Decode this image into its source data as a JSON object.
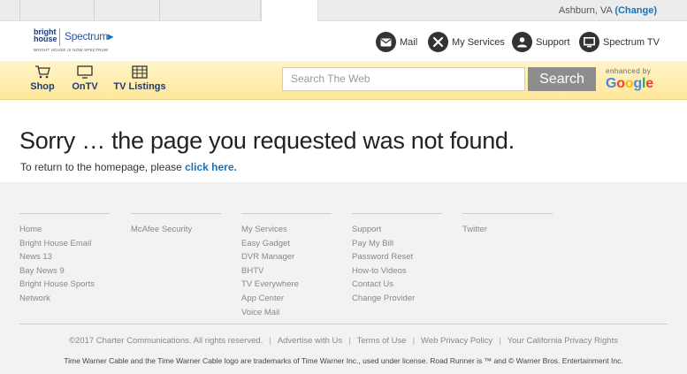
{
  "top": {
    "location": "Ashburn, VA",
    "change": "(Change)"
  },
  "logo": {
    "bright": "bright",
    "house": "house",
    "spectrum": "Spectrum",
    "tagline": "BRIGHT HOUSE IS NOW SPECTRUM"
  },
  "services": {
    "mail": "Mail",
    "my_services": "My Services",
    "support": "Support",
    "spectrum_tv": "Spectrum TV"
  },
  "nav": {
    "shop": "Shop",
    "ontv": "OnTV",
    "tv_listings": "TV Listings"
  },
  "search": {
    "placeholder": "Search The Web",
    "button": "Search",
    "enhanced": "enhanced by",
    "google": [
      "G",
      "o",
      "o",
      "g",
      "l",
      "e"
    ]
  },
  "error": {
    "title": "Sorry … the page you requested was not found.",
    "prefix": "To return to the homepage, please ",
    "link": "click here."
  },
  "footer": {
    "col1": [
      "Home",
      "Bright House Email",
      "News 13",
      "Bay News 9",
      "Bright House Sports",
      "Network"
    ],
    "col2": [
      "McAfee Security"
    ],
    "col3": [
      "My Services",
      "Easy Gadget",
      "DVR Manager",
      "BHTV",
      "TV Everywhere",
      "App Center",
      "Voice Mail"
    ],
    "col4": [
      "Support",
      "Pay My Bill",
      "Password Reset",
      "How-to Videos",
      "Contact Us",
      "Change Provider"
    ],
    "col5": [
      "Twitter"
    ],
    "legal": [
      "©2017 Charter Communications. All rights reserved.",
      "Advertise with Us",
      "Terms of Use",
      "Web Privacy Policy",
      "Your California Privacy Rights"
    ],
    "trademark": "Time Warner Cable and the Time Warner Cable logo are trademarks of Time Warner Inc., used under license. Road Runner is ™ and © Warner Bros. Entertainment Inc."
  },
  "colors": {
    "link_blue": "#1a74b8",
    "nav_yellow": "#ffe89a",
    "search_button": "#8d8d8d"
  }
}
